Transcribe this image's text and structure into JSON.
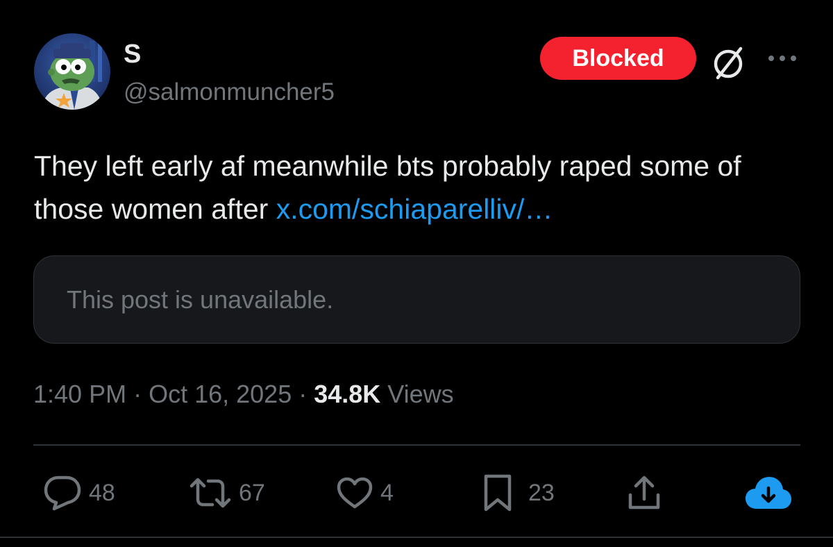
{
  "author": {
    "display_name": "S",
    "handle": "@salmonmuncher5"
  },
  "badge": {
    "label": "Blocked",
    "color": "#f4212e"
  },
  "icons": {
    "avatar": "cartoon-avatar",
    "grok": "grok-icon",
    "more": "more-options-icon"
  },
  "post": {
    "text": "They left early af meanwhile bts probably raped some of those women after ",
    "link": "x.com/schiaparelliv/…",
    "link_color": "#1d9bf0"
  },
  "quoted": {
    "message": "This post is unavailable."
  },
  "meta": {
    "time": "1:40 PM",
    "separator": " · ",
    "date": "Oct 16, 2025",
    "views_count": "34.8K",
    "views_label": " Views"
  },
  "actions": {
    "replies": "48",
    "reposts": "67",
    "likes": "4",
    "bookmarks": "23"
  }
}
